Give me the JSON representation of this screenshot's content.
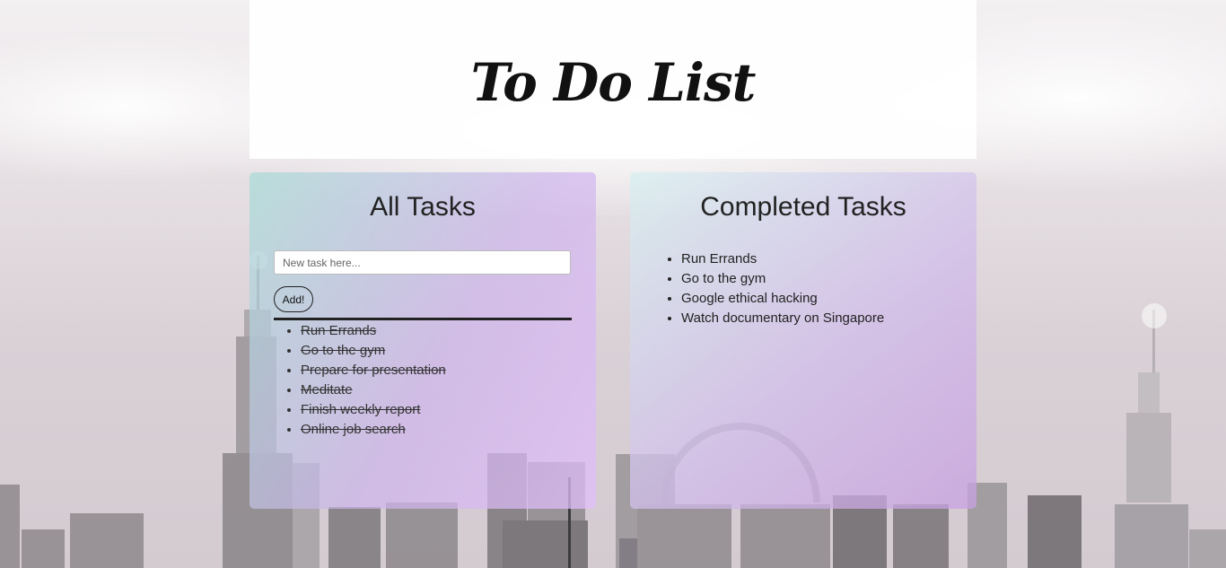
{
  "header": {
    "title": "To Do List"
  },
  "all_tasks": {
    "heading": "All Tasks",
    "input_placeholder": "New task here...",
    "add_label": "Add!",
    "items": [
      "Run Errands",
      "Go to the gym",
      "Prepare for presentation",
      "Meditate",
      "Finish weekly report",
      "Online job search"
    ]
  },
  "completed_tasks": {
    "heading": "Completed Tasks",
    "items": [
      "Run Errands",
      "Go to the gym",
      "Google ethical hacking",
      "Watch documentary on Singapore"
    ]
  }
}
